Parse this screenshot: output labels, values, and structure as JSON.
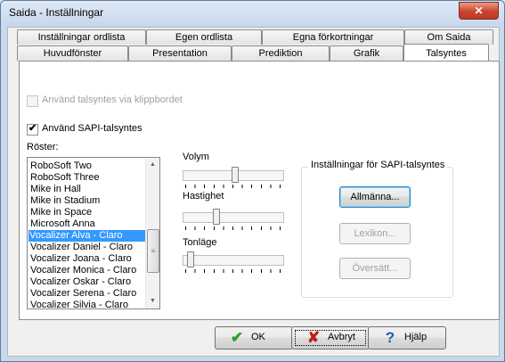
{
  "window": {
    "title": "Saida - Inställningar",
    "close_label": "✕"
  },
  "tabs_row1": [
    "Inställningar ordlista",
    "Egen ordlista",
    "Egna förkortningar",
    "Om Saida"
  ],
  "tabs_row2": [
    "Huvudfönster",
    "Presentation",
    "Prediktion",
    "Grafik",
    "Talsyntes"
  ],
  "active_tab": "Talsyntes",
  "clipboard": {
    "label": "Använd talsyntes via klippbordet",
    "checked": false,
    "enabled": false
  },
  "sapi": {
    "label": "Använd SAPI-talsyntes",
    "checked": true
  },
  "voices": {
    "label": "Röster:",
    "items": [
      "RoboSoft Two",
      "RoboSoft Three",
      "Mike in Hall",
      "Mike in Stadium",
      "Mike in Space",
      "Microsoft Anna",
      "Vocalizer Alva - Claro",
      "Vocalizer Daniel - Claro",
      "Vocalizer Joana - Claro",
      "Vocalizer Monica - Claro",
      "Vocalizer Oskar - Claro",
      "Vocalizer Serena - Claro",
      "Vocalizer Silvia - Claro"
    ],
    "selected": "Vocalizer Alva - Claro"
  },
  "sliders": {
    "volume": {
      "label": "Volym",
      "value": 0.52
    },
    "speed": {
      "label": "Hastighet",
      "value": 0.32
    },
    "pitch": {
      "label": "Tonläge",
      "value": 0.05
    }
  },
  "sapi_settings": {
    "label": "Inställningar för SAPI-talsyntes",
    "general": "Allmänna...",
    "lexicon": "Lexikon...",
    "translate": "Översätt..."
  },
  "buttons": {
    "ok": "OK",
    "cancel": "Avbryt",
    "help": "Hjälp"
  },
  "colors": {
    "ok_icon": "#2e9e2e",
    "cancel_icon": "#c0201b",
    "help_icon": "#1d5db6",
    "selection": "#3399ff"
  }
}
